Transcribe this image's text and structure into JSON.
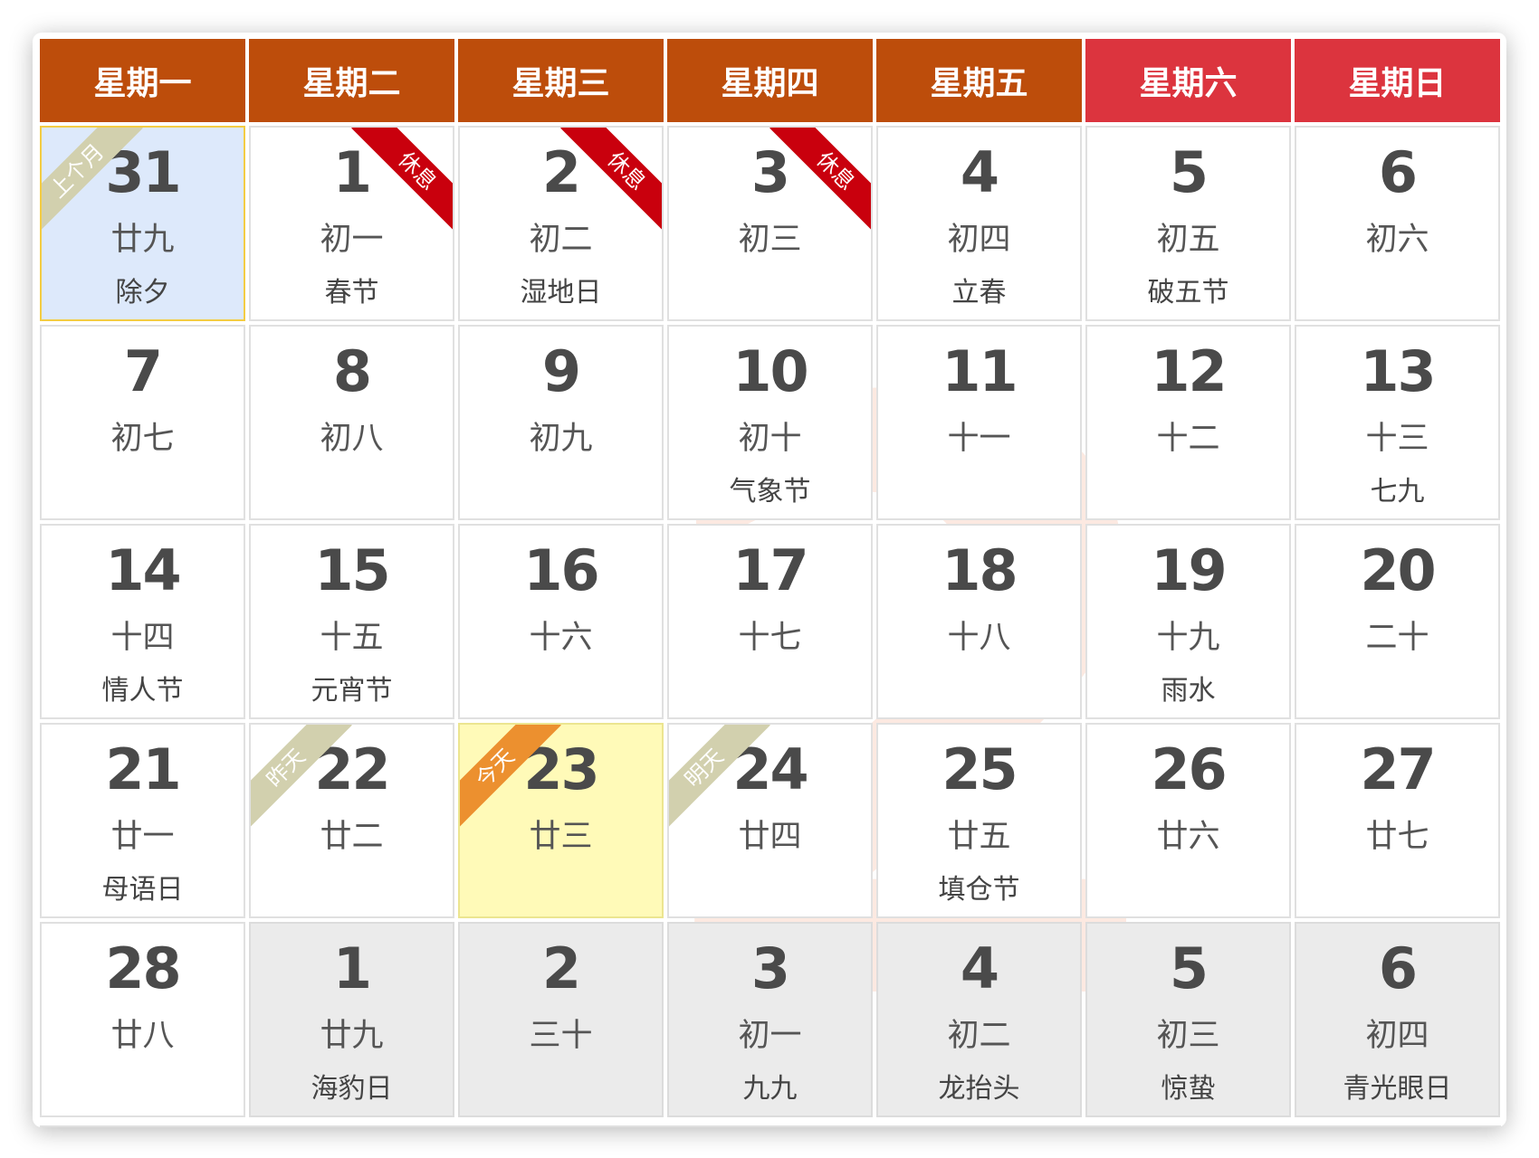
{
  "weekdays": [
    {
      "label": "星期一",
      "weekend": false
    },
    {
      "label": "星期二",
      "weekend": false
    },
    {
      "label": "星期三",
      "weekend": false
    },
    {
      "label": "星期四",
      "weekend": false
    },
    {
      "label": "星期五",
      "weekend": false
    },
    {
      "label": "星期六",
      "weekend": true
    },
    {
      "label": "星期日",
      "weekend": true
    }
  ],
  "month_watermark": "2",
  "colors": {
    "header": "#bd4d0b",
    "weekend_header": "#dc343e",
    "rest_ribbon": "#c9000d",
    "today_ribbon": "#ec902f",
    "today_bg": "#fffab8",
    "prev_month_bg": "#dde9fb",
    "next_month_bg": "#ebebeb"
  },
  "days": [
    {
      "day": "31",
      "lunar": "廿九",
      "festival": "除夕",
      "state": "prev",
      "tag": "上个月",
      "tag_style": "left"
    },
    {
      "day": "1",
      "lunar": "初一",
      "festival": "春节",
      "tag": "休息",
      "tag_style": "right"
    },
    {
      "day": "2",
      "lunar": "初二",
      "festival": "湿地日",
      "tag": "休息",
      "tag_style": "right"
    },
    {
      "day": "3",
      "lunar": "初三",
      "festival": "",
      "tag": "休息",
      "tag_style": "right"
    },
    {
      "day": "4",
      "lunar": "初四",
      "festival": "立春"
    },
    {
      "day": "5",
      "lunar": "初五",
      "festival": "破五节"
    },
    {
      "day": "6",
      "lunar": "初六",
      "festival": ""
    },
    {
      "day": "7",
      "lunar": "初七",
      "festival": ""
    },
    {
      "day": "8",
      "lunar": "初八",
      "festival": ""
    },
    {
      "day": "9",
      "lunar": "初九",
      "festival": ""
    },
    {
      "day": "10",
      "lunar": "初十",
      "festival": "气象节"
    },
    {
      "day": "11",
      "lunar": "十一",
      "festival": ""
    },
    {
      "day": "12",
      "lunar": "十二",
      "festival": ""
    },
    {
      "day": "13",
      "lunar": "十三",
      "festival": "七九"
    },
    {
      "day": "14",
      "lunar": "十四",
      "festival": "情人节"
    },
    {
      "day": "15",
      "lunar": "十五",
      "festival": "元宵节"
    },
    {
      "day": "16",
      "lunar": "十六",
      "festival": ""
    },
    {
      "day": "17",
      "lunar": "十七",
      "festival": ""
    },
    {
      "day": "18",
      "lunar": "十八",
      "festival": ""
    },
    {
      "day": "19",
      "lunar": "十九",
      "festival": "雨水"
    },
    {
      "day": "20",
      "lunar": "二十",
      "festival": ""
    },
    {
      "day": "21",
      "lunar": "廿一",
      "festival": "母语日"
    },
    {
      "day": "22",
      "lunar": "廿二",
      "festival": "",
      "tag": "昨天",
      "tag_style": "left"
    },
    {
      "day": "23",
      "lunar": "廿三",
      "festival": "",
      "state": "today",
      "tag": "今天",
      "tag_style": "left"
    },
    {
      "day": "24",
      "lunar": "廿四",
      "festival": "",
      "tag": "明天",
      "tag_style": "left"
    },
    {
      "day": "25",
      "lunar": "廿五",
      "festival": "填仓节"
    },
    {
      "day": "26",
      "lunar": "廿六",
      "festival": ""
    },
    {
      "day": "27",
      "lunar": "廿七",
      "festival": ""
    },
    {
      "day": "28",
      "lunar": "廿八",
      "festival": ""
    },
    {
      "day": "1",
      "lunar": "廿九",
      "festival": "海豹日",
      "state": "next"
    },
    {
      "day": "2",
      "lunar": "三十",
      "festival": "",
      "state": "next"
    },
    {
      "day": "3",
      "lunar": "初一",
      "festival": "九九",
      "state": "next"
    },
    {
      "day": "4",
      "lunar": "初二",
      "festival": "龙抬头",
      "state": "next"
    },
    {
      "day": "5",
      "lunar": "初三",
      "festival": "惊蛰",
      "state": "next"
    },
    {
      "day": "6",
      "lunar": "初四",
      "festival": "青光眼日",
      "state": "next"
    }
  ]
}
